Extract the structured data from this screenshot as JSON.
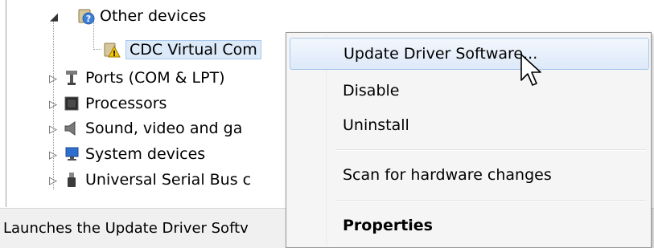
{
  "tree": {
    "items": [
      {
        "label": "Other devices",
        "icon": "other-devices-icon",
        "expander": "expanded"
      },
      {
        "label": "CDC Virtual Com",
        "icon": "warning-device-icon"
      },
      {
        "label": "Ports (COM & LPT)",
        "icon": "port-icon",
        "expander": "collapsed"
      },
      {
        "label": "Processors",
        "icon": "processor-icon",
        "expander": "collapsed"
      },
      {
        "label": "Sound, video and ga",
        "icon": "speaker-icon",
        "expander": "collapsed"
      },
      {
        "label": "System devices",
        "icon": "system-devices-icon",
        "expander": "collapsed"
      },
      {
        "label": "Universal Serial Bus c",
        "icon": "usb-icon",
        "expander": "collapsed"
      }
    ]
  },
  "status_bar": {
    "text": "Launches the Update Driver Softv"
  },
  "context_menu": {
    "items": [
      {
        "label": "Update Driver Software...",
        "state": "hover"
      },
      {
        "label": "Disable"
      },
      {
        "label": "Uninstall"
      },
      {
        "label": "Scan for hardware changes"
      },
      {
        "label": "Properties",
        "style": "bold"
      }
    ]
  },
  "colors": {
    "hover_border": "#a8c8ef",
    "warning": "#f5c400",
    "menu_bg": "#f5f5f5"
  }
}
